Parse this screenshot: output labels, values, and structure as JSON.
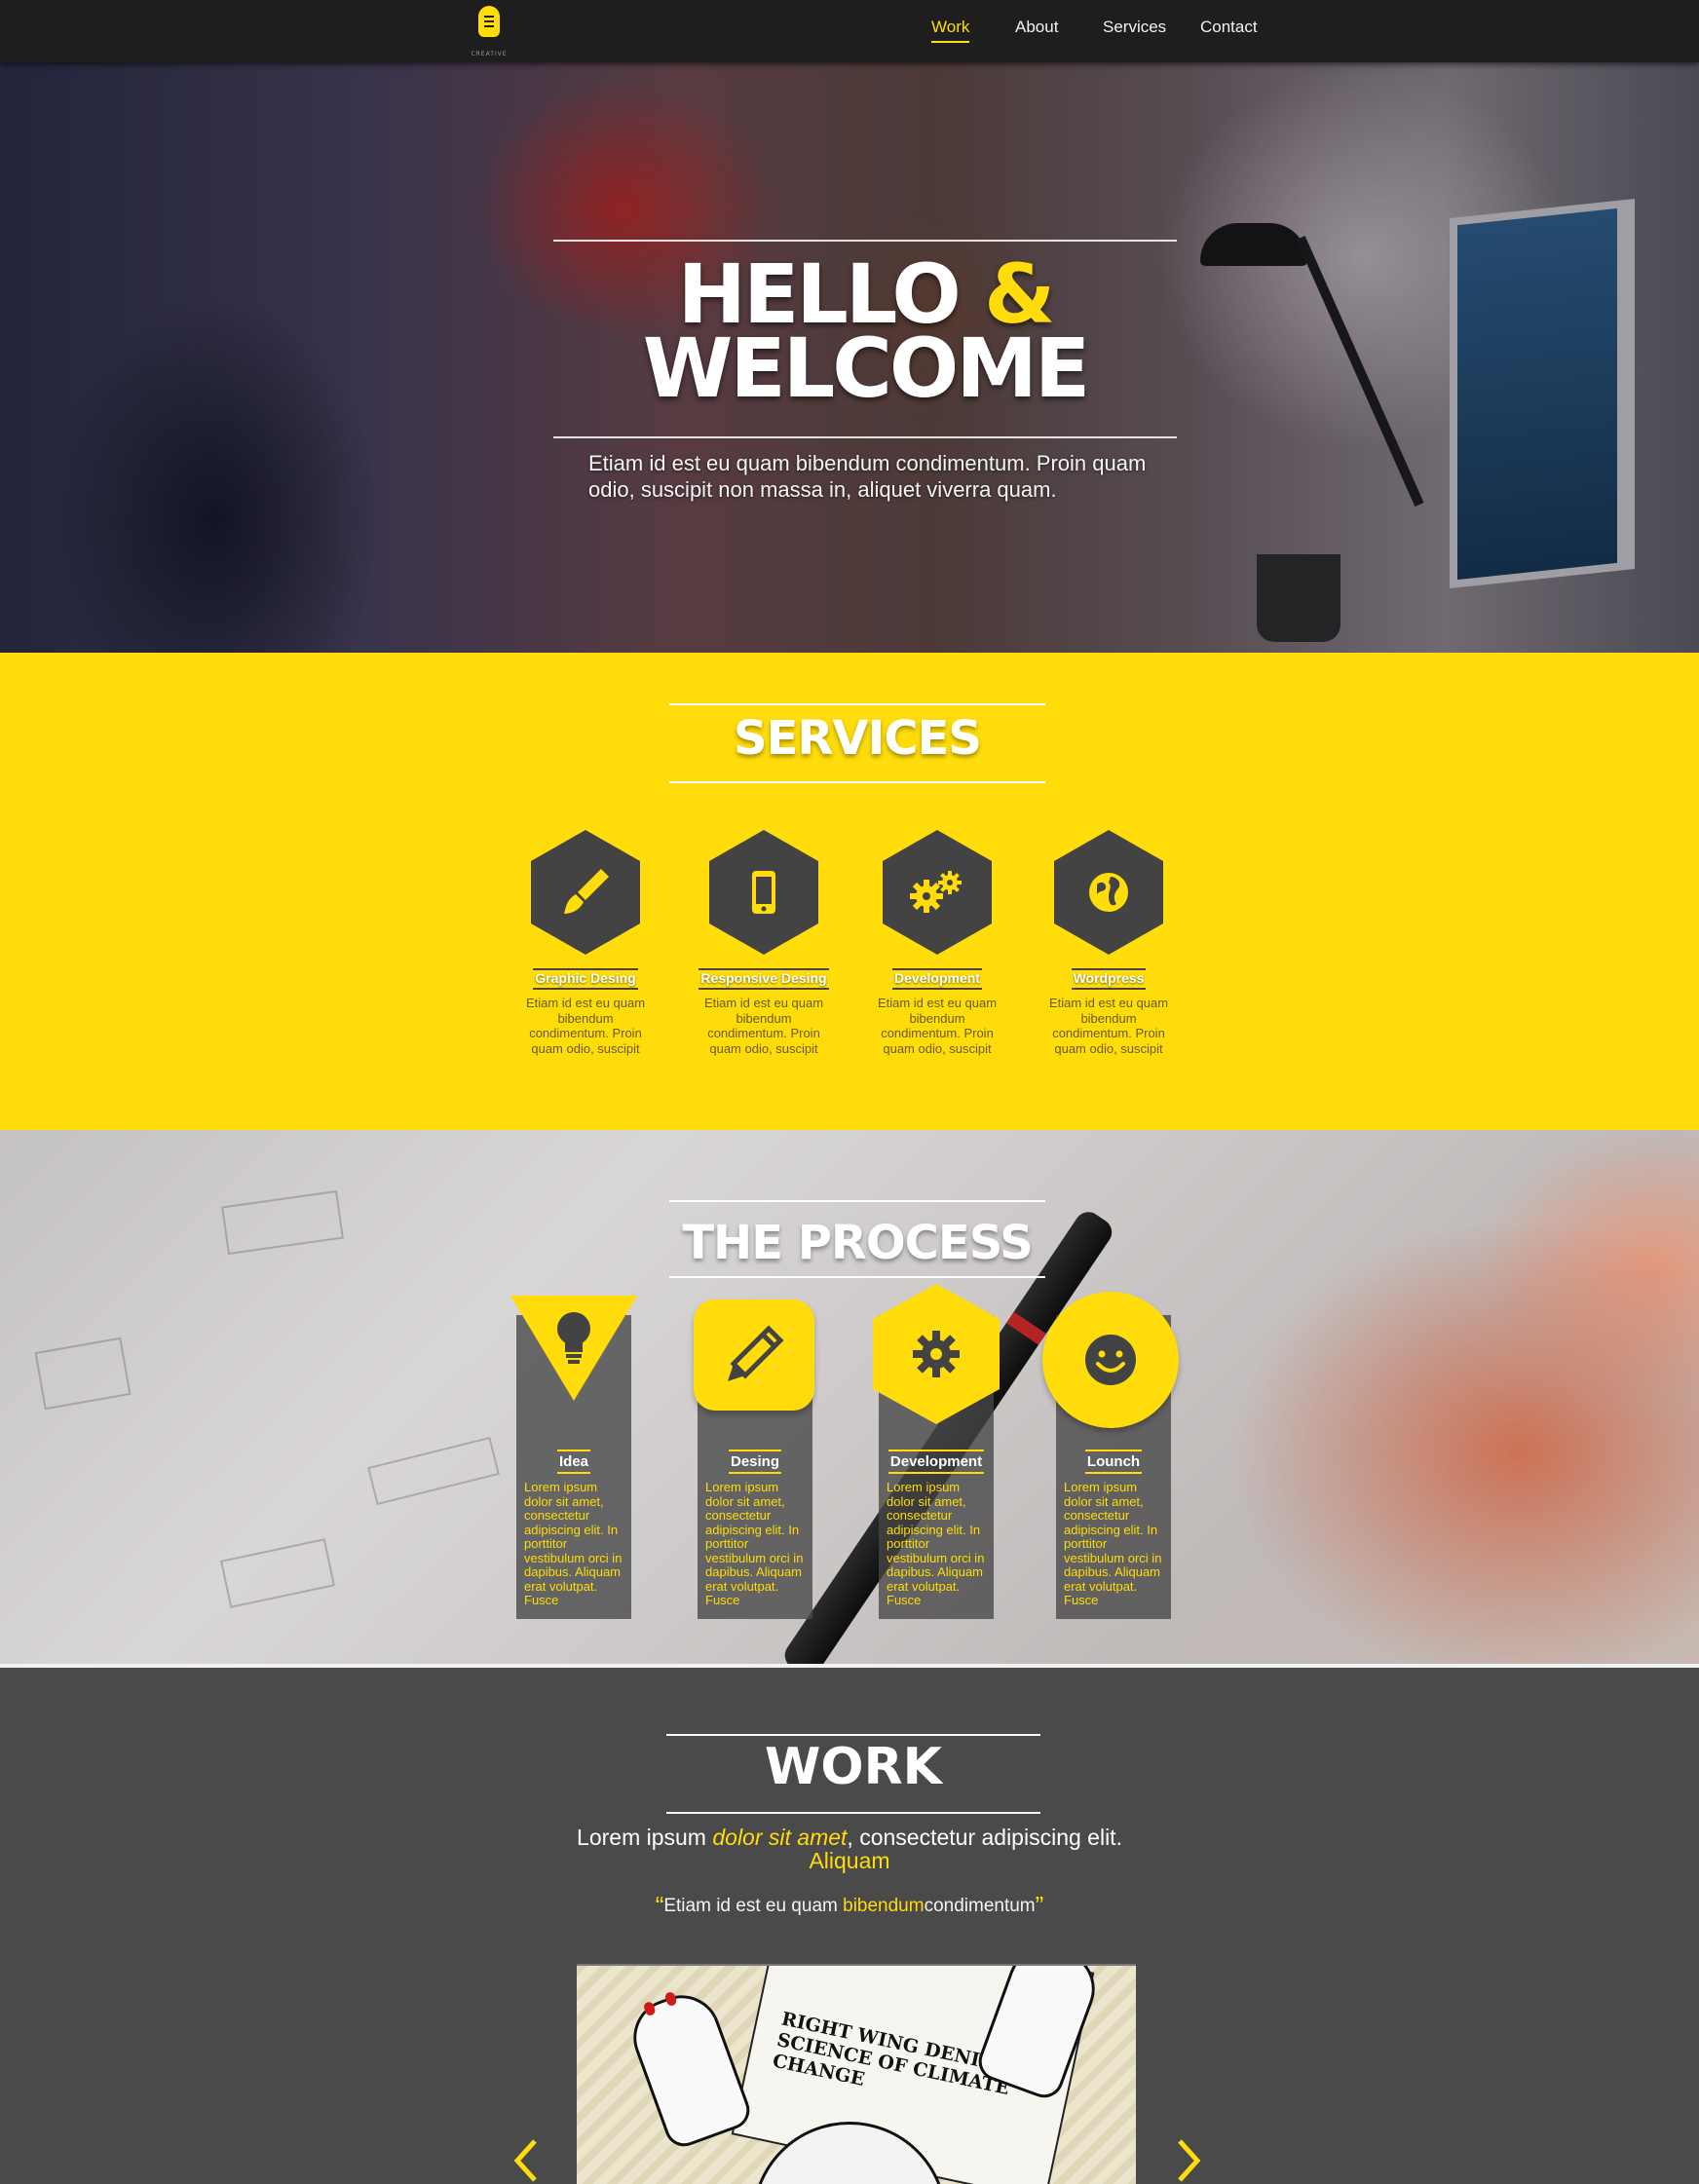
{
  "nav": {
    "logo_text": "CREATIVE",
    "items": [
      {
        "label": "Work",
        "active": true
      },
      {
        "label": "About",
        "active": false
      },
      {
        "label": "Services",
        "active": false
      },
      {
        "label": "Contact",
        "active": false
      }
    ]
  },
  "hero": {
    "title_line1": "HELLO",
    "title_amp": "&",
    "title_line2": "WELCOME",
    "subtitle": "Etiam id est eu quam bibendum condimentum. Proin quam odio, suscipit non massa in, aliquet viverra quam."
  },
  "services": {
    "title": "SERVICES",
    "items": [
      {
        "icon": "paintbrush-icon",
        "label": "Graphic Desing",
        "text": "Etiam id est eu quam bibendum condimentum. Proin quam odio, suscipit"
      },
      {
        "icon": "smartphone-icon",
        "label": "Responsive Desing",
        "text": "Etiam id est eu quam bibendum condimentum. Proin quam odio, suscipit"
      },
      {
        "icon": "gears-icon",
        "label": "Development",
        "text": "Etiam id est eu quam bibendum condimentum. Proin quam odio, suscipit"
      },
      {
        "icon": "globe-icon",
        "label": "Wordpress",
        "text": "Etiam id est eu quam bibendum condimentum. Proin quam odio, suscipit"
      }
    ]
  },
  "process": {
    "title": "THE PROCESS",
    "items": [
      {
        "icon": "lightbulb-icon",
        "label": "Idea",
        "text": "Lorem ipsum dolor sit amet, consectetur adipiscing elit. In porttitor vestibulum orci in dapibus. Aliquam erat volutpat. Fusce"
      },
      {
        "icon": "pencil-icon",
        "label": "Desing",
        "text": "Lorem ipsum dolor sit amet, consectetur adipiscing elit. In porttitor vestibulum orci in dapibus. Aliquam erat volutpat. Fusce"
      },
      {
        "icon": "gear-icon",
        "label": "Development",
        "text": "Lorem ipsum dolor sit amet, consectetur adipiscing elit. In porttitor vestibulum orci in dapibus. Aliquam erat volutpat. Fusce"
      },
      {
        "icon": "smiley-icon",
        "label": "Lounch",
        "text": "Lorem ipsum dolor sit amet, consectetur adipiscing elit. In porttitor vestibulum orci in dapibus. Aliquam erat volutpat. Fusce"
      }
    ]
  },
  "work": {
    "title": "WORK",
    "sub_part1": "Lorem ipsum ",
    "sub_em": "dolor sit amet",
    "sub_part2": ", consectetur adipiscing elit. ",
    "sub_hl": "Aliquam",
    "quote_open": "“",
    "quote_part1": "Etiam id est eu quam ",
    "quote_hl": "bibendum",
    "quote_part2": "condimentum",
    "quote_close": "”",
    "image_headline": "RIGHT WING DENIES SCIENCE OF CLIMATE CHANGE",
    "prev_icon": "chevron-left-icon",
    "next_icon": "chevron-right-icon"
  },
  "colors": {
    "accent": "#ffdc0a",
    "dark": "#434343",
    "nav_bg": "#1e1e1e",
    "work_bg": "#4a4a4a"
  }
}
